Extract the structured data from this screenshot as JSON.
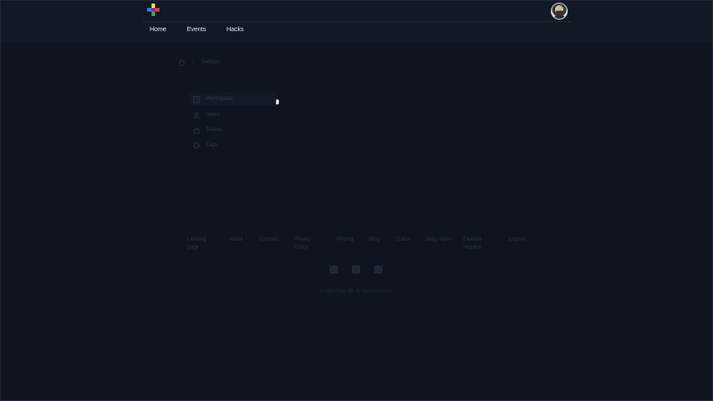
{
  "header": {
    "nav": [
      {
        "label": "Home"
      },
      {
        "label": "Events"
      },
      {
        "label": "Hacks"
      }
    ],
    "logo_colors": [
      "#1e88e5",
      "#e53935",
      "#43a047",
      "#fdd835"
    ]
  },
  "breadcrumb": {
    "current": "Settings"
  },
  "settings_menu": {
    "items": [
      {
        "label": "Workspace",
        "icon": "building-icon",
        "active": true
      },
      {
        "label": "Users",
        "icon": "user-icon",
        "active": false
      },
      {
        "label": "Teams",
        "icon": "team-icon",
        "active": false
      },
      {
        "label": "Tags",
        "icon": "tag-icon",
        "active": false
      }
    ]
  },
  "footer": {
    "links": [
      {
        "label": "Landing page"
      },
      {
        "label": "About"
      },
      {
        "label": "Contact"
      },
      {
        "label": "Privacy Policy"
      },
      {
        "label": "Pricing"
      },
      {
        "label": "Blog"
      },
      {
        "label": "Status"
      },
      {
        "label": "Bug report"
      },
      {
        "label": "Feature request"
      },
      {
        "label": "Logout"
      }
    ],
    "social": [
      "twitter-icon",
      "linkedin-icon",
      "instagram-icon"
    ],
    "copyright": "© 2023 Hack AB. All rights reserved."
  }
}
